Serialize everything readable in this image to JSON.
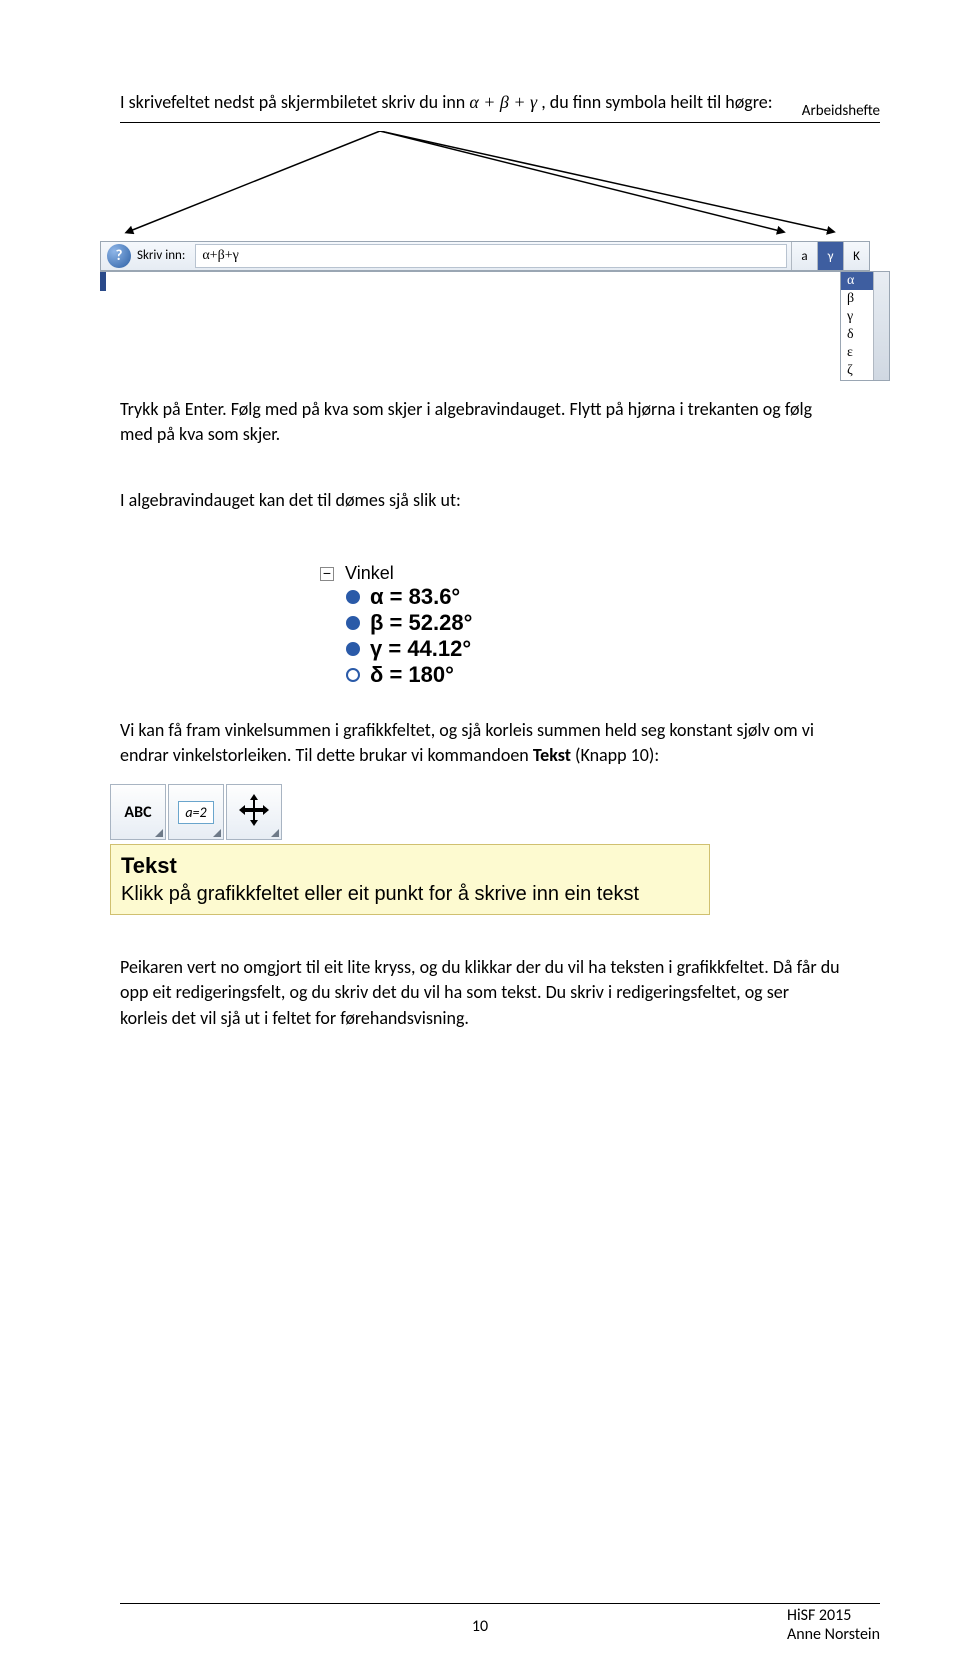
{
  "header": {
    "label": "Arbeidshefte"
  },
  "intro": {
    "line1_pre": "I skrivefeltet nedst på skjermbiletet skriv du inn ",
    "formula": "α + β + γ",
    "line1_post": " , du finn symbola heilt til høgre:"
  },
  "inputbar": {
    "label": "Skriv inn:",
    "value": "α+β+γ",
    "deg_symbol": "a",
    "gamma_btn": "γ",
    "k_btn": "K",
    "dropdown": [
      "α",
      "β",
      "γ",
      "δ",
      "ε",
      "ζ"
    ],
    "selected_index": 0
  },
  "para2": "Trykk på Enter. Følg med på kva som skjer i algebravindauget. Flytt på hjørna i trekanten og følg med på kva som skjer.",
  "para3": "I algebravindauget kan det til dømes sjå slik ut:",
  "vinkel": {
    "title": "Vinkel",
    "rows": [
      {
        "sym": "α",
        "val": "83.6°",
        "filled": true
      },
      {
        "sym": "β",
        "val": "52.28°",
        "filled": true
      },
      {
        "sym": "γ",
        "val": "44.12°",
        "filled": true
      },
      {
        "sym": "δ",
        "val": "180°",
        "filled": false
      }
    ]
  },
  "para4_pre": "Vi kan få fram vinkelsummen i grafikkfeltet, og sjå korleis summen held seg konstant sjølv om vi endrar vinkelstorleiken. Til dette brukar vi kommandoen ",
  "para4_bold": "Tekst",
  "para4_post": " (Knapp 10):",
  "toolbar": {
    "abc": "ABC",
    "a2": "a=2"
  },
  "tooltip": {
    "title": "Tekst",
    "desc": "Klikk på grafikkfeltet eller eit punkt for å skrive inn ein tekst"
  },
  "para5": "Peikaren vert no omgjort til eit lite kryss, og du klikkar der du vil ha teksten i grafikkfeltet. Då får du opp eit redigeringsfelt, og du skriv det du vil ha som tekst. Du skriv i redigeringsfeltet, og ser korleis det vil sjå ut i feltet for førehandsvisning.",
  "footer": {
    "page": "10",
    "right1": "HiSF 2015",
    "right2": "Anne Norstein"
  }
}
